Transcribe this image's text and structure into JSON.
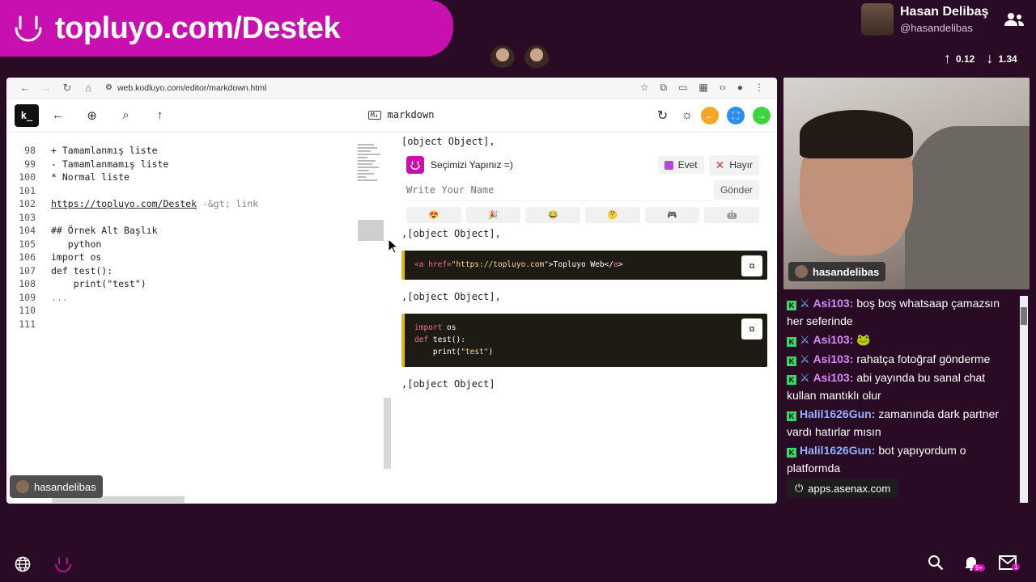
{
  "banner": {
    "text": "topluyo.com/Destek",
    "icon": "smile-icon",
    "color": "#c80fb0"
  },
  "streamer": {
    "name": "Hasan Delibaş",
    "handle": "@hasandelibas"
  },
  "stats": {
    "up": "0.12",
    "down": "1.34"
  },
  "browser": {
    "url": "web.kodluyo.com/editor/markdown.html"
  },
  "app": {
    "logo": "k_",
    "title": "markdown"
  },
  "editor": {
    "lines": [
      {
        "no": "98",
        "text": "+ Tamamlanmış liste"
      },
      {
        "no": "99",
        "text": "- Tamamlanmamış liste"
      },
      {
        "no": "100",
        "text": "* Normal liste"
      },
      {
        "no": "101",
        "text": ""
      },
      {
        "no": "102",
        "text_link": "https://topluyo.com/Destek",
        "text": " -&gt; link"
      },
      {
        "no": "103",
        "text": ""
      },
      {
        "no": "104",
        "text": "## Örnek Alt Başlık"
      },
      {
        "no": "105",
        "text": "   python"
      },
      {
        "no": "106",
        "text": "import os"
      },
      {
        "no": "107",
        "text": "def test():"
      },
      {
        "no": "108",
        "text": "    print(\"test\")"
      },
      {
        "no": "109",
        "text": "..."
      },
      {
        "no": "110",
        "text": ""
      },
      {
        "no": "111",
        "text": ""
      }
    ]
  },
  "preview": {
    "obj1": "[object Object],",
    "poll": {
      "title": "Seçimizi Yapınız =)",
      "yes": "Evet",
      "no": "Hayır",
      "placeholder": "Write Your Name",
      "send": "Gönder"
    },
    "obj2": ",[object Object],",
    "code1": {
      "open": "<",
      "tag": "a",
      "attr": " href=",
      "val": "\"https://topluyo.com\"",
      "text": ">Topluyo Web</",
      "close_tag": "a",
      "end": ">"
    },
    "obj3": ",[object Object],",
    "code2": {
      "kw1": "import",
      "l1": " os",
      "kw2": "def",
      "l2": " test():",
      "l3": "    print(",
      "str": "\"test\"",
      "l3e": ")"
    },
    "obj4": ",[object Object]"
  },
  "cam": {
    "tag": "hasandelibas"
  },
  "chat": [
    {
      "user": "Asi103:",
      "color": "#d58bf7",
      "text": "boş boş whatsaap çamazsın her seferinde"
    },
    {
      "user": "Asi103:",
      "color": "#d58bf7",
      "text": "🐸"
    },
    {
      "user": "Asi103:",
      "color": "#d58bf7",
      "text": "rahatça fotoğraf gönderme"
    },
    {
      "user": "Asi103:",
      "color": "#d58bf7",
      "text": "abi yayında bu sanal chat kullan mantıklı olur"
    },
    {
      "user": "Halil1626Gun:",
      "color": "#8fb3ff",
      "text": "zamanında dark partner vardı hatırlar mısın",
      "noSword": true
    },
    {
      "user": "Halil1626Gun:",
      "color": "#8fb3ff",
      "text": "bot yapıyordum o platformda",
      "noSword": true
    }
  ],
  "overlay_site": "apps.asenax.com",
  "cam_small_tag": "hasandelibas",
  "badges": {
    "notif": "9+",
    "mail": "1"
  }
}
